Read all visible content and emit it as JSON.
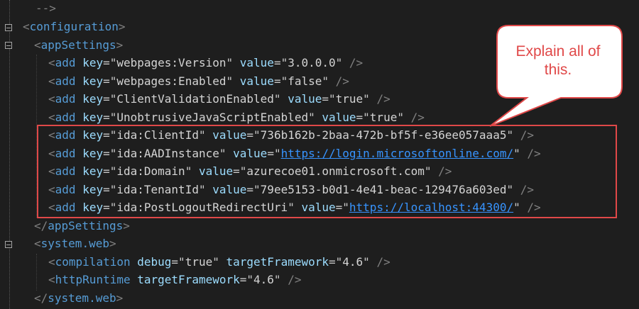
{
  "editor": {
    "lines": {
      "l0": {
        "comment": "-->"
      },
      "l1": {
        "open": "<",
        "tag": "configuration",
        "close": ">"
      },
      "l2": {
        "open": "<",
        "tag": "appSettings",
        "close": ">"
      },
      "l3": {
        "tag": "add",
        "key_attr": "key",
        "key": "webpages:Version",
        "val_attr": "value",
        "val": "3.0.0.0"
      },
      "l4": {
        "tag": "add",
        "key_attr": "key",
        "key": "webpages:Enabled",
        "val_attr": "value",
        "val": "false"
      },
      "l5": {
        "tag": "add",
        "key_attr": "key",
        "key": "ClientValidationEnabled",
        "val_attr": "value",
        "val": "true"
      },
      "l6": {
        "tag": "add",
        "key_attr": "key",
        "key": "UnobtrusiveJavaScriptEnabled",
        "val_attr": "value",
        "val": "true"
      },
      "l7": {
        "tag": "add",
        "key_attr": "key",
        "key": "ida:ClientId",
        "val_attr": "value",
        "val": "736b162b-2baa-472b-bf5f-e36ee057aaa5"
      },
      "l8": {
        "tag": "add",
        "key_attr": "key",
        "key": "ida:AADInstance",
        "val_attr": "value",
        "val": "https://login.microsoftonline.com/"
      },
      "l9": {
        "tag": "add",
        "key_attr": "key",
        "key": "ida:Domain",
        "val_attr": "value",
        "val": "azurecoe01.onmicrosoft.com"
      },
      "l10": {
        "tag": "add",
        "key_attr": "key",
        "key": "ida:TenantId",
        "val_attr": "value",
        "val": "79ee5153-b0d1-4e41-beac-129476a603ed"
      },
      "l11": {
        "tag": "add",
        "key_attr": "key",
        "key": "ida:PostLogoutRedirectUri",
        "val_attr": "value",
        "val": "https://localhost:44300/"
      },
      "l12": {
        "tag": "appSettings"
      },
      "l13": {
        "tag": "system.web"
      },
      "l14": {
        "tag": "compilation",
        "a1": "debug",
        "v1": "true",
        "a2": "targetFramework",
        "v2": "4.6"
      },
      "l15": {
        "tag": "httpRuntime",
        "a1": "targetFramework",
        "v1": "4.6"
      },
      "l16": {
        "tag": "system.web"
      }
    }
  },
  "callout": {
    "text": "Explain all of this.",
    "color": "#e04848"
  },
  "colors": {
    "background": "#1e1e1e",
    "tag": "#569cd6",
    "attribute": "#9cdcfe",
    "value": "#d4d4d4",
    "link": "#3794ff",
    "highlight": "#e04848"
  }
}
